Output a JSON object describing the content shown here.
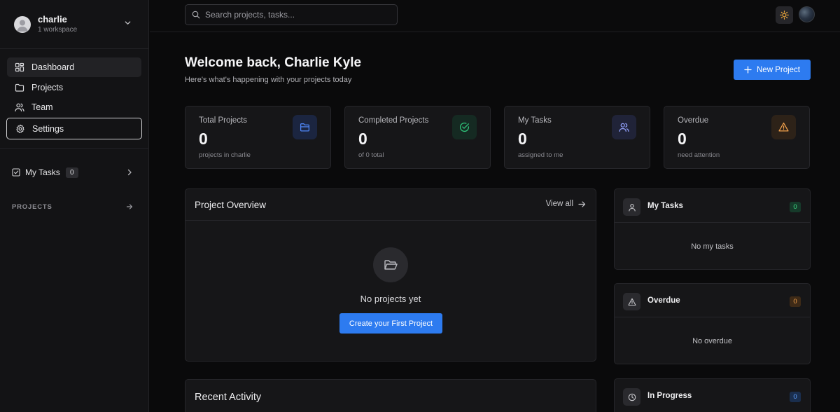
{
  "workspace": {
    "name": "charlie",
    "subtitle": "1 workspace"
  },
  "nav": [
    {
      "label": "Dashboard",
      "icon": "dashboard-grid-icon"
    },
    {
      "label": "Projects",
      "icon": "folder-icon"
    },
    {
      "label": "Team",
      "icon": "users-icon"
    },
    {
      "label": "Settings",
      "icon": "gear-icon"
    }
  ],
  "sidebar_my_tasks": {
    "label": "My Tasks",
    "count": "0"
  },
  "sidebar_projects": {
    "label": "PROJECTS"
  },
  "search": {
    "placeholder": "Search projects, tasks..."
  },
  "header": {
    "title": "Welcome back, Charlie Kyle",
    "subtitle": "Here's what's happening with your projects today",
    "new_project_label": "New Project"
  },
  "stats": [
    {
      "label": "Total Projects",
      "value": "0",
      "sub": "projects in charlie",
      "icon": "folder-icon",
      "color": "#4f86f7"
    },
    {
      "label": "Completed Projects",
      "value": "0",
      "sub": "of 0 total",
      "icon": "check-circle-icon",
      "color": "#2fc57a"
    },
    {
      "label": "My Tasks",
      "value": "0",
      "sub": "assigned to me",
      "icon": "users-icon",
      "color": "#8e9cf5"
    },
    {
      "label": "Overdue",
      "value": "0",
      "sub": "need attention",
      "icon": "alert-triangle-icon",
      "color": "#f0a04b"
    }
  ],
  "project_overview": {
    "title": "Project Overview",
    "view_all": "View all",
    "empty_text": "No projects yet",
    "create_label": "Create your First Project"
  },
  "side_panels": {
    "my_tasks": {
      "title": "My Tasks",
      "count": "0",
      "empty": "No my tasks"
    },
    "overdue": {
      "title": "Overdue",
      "count": "0",
      "empty": "No overdue"
    },
    "in_progress": {
      "title": "In Progress",
      "count": "0"
    }
  },
  "recent_activity": {
    "title": "Recent Activity"
  },
  "colors": {
    "accent": "#2d7bf0",
    "background": "#0a0a0b",
    "surface": "#161618"
  }
}
